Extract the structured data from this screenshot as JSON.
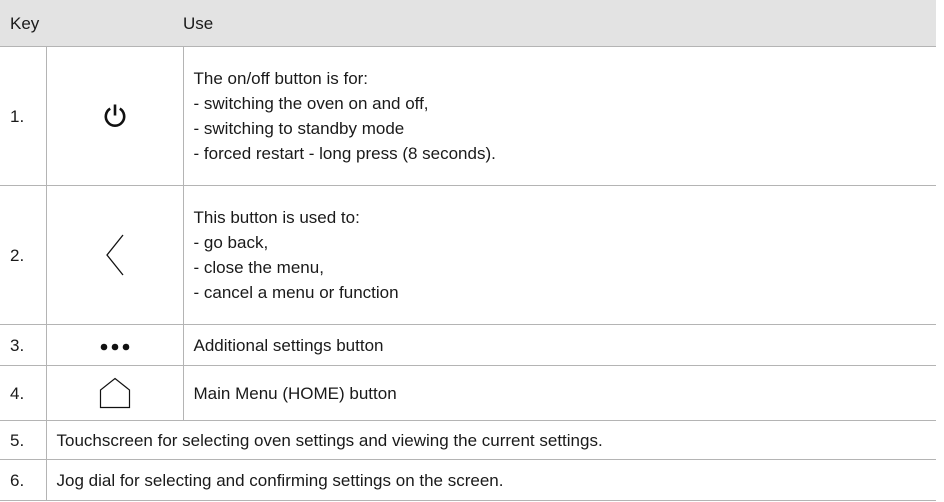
{
  "table": {
    "header": {
      "key": "Key",
      "use": "Use"
    },
    "rows": [
      {
        "num": "1.",
        "icon": "power-icon",
        "lines": [
          "The on/off button is for:",
          "- switching the oven on and off,",
          "- switching to standby mode",
          "- forced restart - long press (8 seconds)."
        ]
      },
      {
        "num": "2.",
        "icon": "chevron-left-icon",
        "lines": [
          "This button is used to:",
          "- go back,",
          "- close the menu,",
          "- cancel a menu or function"
        ]
      },
      {
        "num": "3.",
        "icon": "more-dots-icon",
        "lines": [
          "Additional settings button"
        ]
      },
      {
        "num": "4.",
        "icon": "home-icon",
        "lines": [
          "Main Menu (HOME) button"
        ]
      },
      {
        "num": "5.",
        "text": "Touchscreen for selecting oven settings and viewing the current settings."
      },
      {
        "num": "6.",
        "text": "Jog dial for selecting and confirming settings on the screen."
      }
    ]
  }
}
